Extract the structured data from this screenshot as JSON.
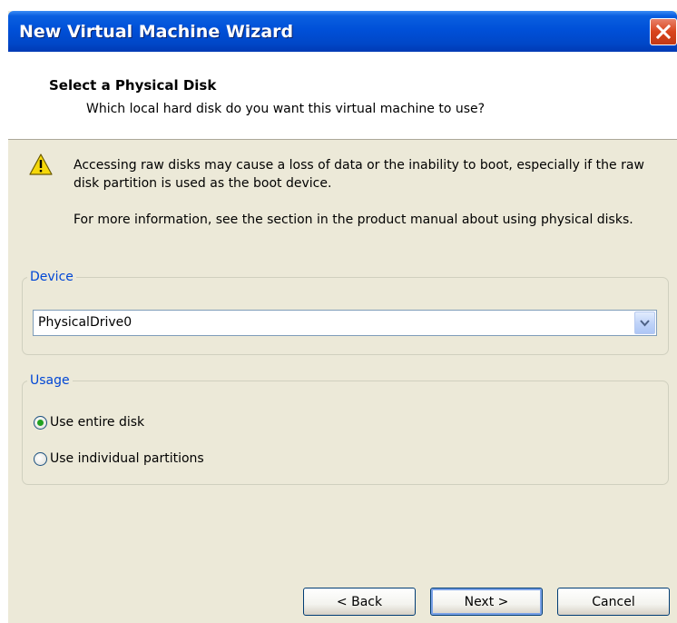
{
  "window": {
    "title": "New Virtual Machine Wizard",
    "close_icon": "close-icon"
  },
  "header": {
    "title": "Select a Physical Disk",
    "subtitle": "Which local hard disk do you want this virtual machine to use?"
  },
  "warning": {
    "icon": "warning-icon",
    "line1": "Accessing raw disks may cause a loss of data or the inability to boot, especially if the raw disk partition is used as the boot device.",
    "line2": "For more information, see the section in the product manual about using physical disks."
  },
  "device": {
    "legend": "Device",
    "selected": "PhysicalDrive0",
    "dropdown_icon": "chevron-down-icon"
  },
  "usage": {
    "legend": "Usage",
    "options": [
      {
        "label": "Use entire disk",
        "checked": true
      },
      {
        "label": "Use individual partitions",
        "checked": false
      }
    ]
  },
  "buttons": {
    "back": "< Back",
    "next": "Next >",
    "cancel": "Cancel"
  },
  "colors": {
    "titlebar": "#0050d8",
    "dialog_bg": "#ece9d8",
    "legend": "#0046d5",
    "radio_dot": "#21a121"
  }
}
